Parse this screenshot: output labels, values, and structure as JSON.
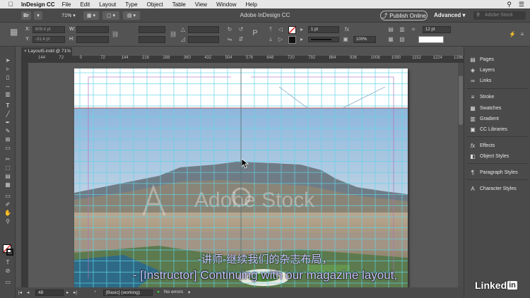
{
  "menubar": {
    "app": "InDesign CC",
    "items": [
      "File",
      "Edit",
      "Layout",
      "Type",
      "Object",
      "Table",
      "View",
      "Window",
      "Help"
    ]
  },
  "appbar": {
    "zoom": "71%",
    "title": "Adobe InDesign CC",
    "publish_label": "Publish Online",
    "workspace": "Advanced",
    "search_placeholder": "Adobe Stock"
  },
  "control": {
    "x_label": "X:",
    "x_value": "609.4 pt",
    "y_label": "Y:",
    "y_value": "-31.4 pt",
    "w_label": "W:",
    "h_label": "H:",
    "stroke_weight": "1 pt",
    "opacity": "100%",
    "gutter": "12 pt"
  },
  "document": {
    "tab_label": "Layout5.indd @ 71%",
    "ruler_ticks": [
      "144",
      "72",
      "0",
      "72",
      "144",
      "216",
      "288",
      "360",
      "432",
      "504",
      "576",
      "648",
      "720",
      "792",
      "864",
      "936",
      "1008",
      "1080",
      "1152",
      "1224",
      "1296"
    ],
    "watermark": "Adobe Stock"
  },
  "status": {
    "page": "48",
    "style": "[Basic] (working)",
    "errors": "No errors"
  },
  "panels": {
    "items": [
      {
        "icon": "pages-icon",
        "label": "Pages"
      },
      {
        "icon": "layers-icon",
        "label": "Layers"
      },
      {
        "icon": "links-icon",
        "label": "Links"
      },
      {
        "icon": "stroke-icon",
        "label": "Stroke"
      },
      {
        "icon": "swatches-icon",
        "label": "Swatches"
      },
      {
        "icon": "gradient-icon",
        "label": "Gradient"
      },
      {
        "icon": "cc-libraries-icon",
        "label": "CC Libraries"
      },
      {
        "icon": "effects-icon",
        "label": "Effects"
      },
      {
        "icon": "object-styles-icon",
        "label": "Object Styles"
      },
      {
        "icon": "paragraph-styles-icon",
        "label": "Paragraph Styles"
      },
      {
        "icon": "character-styles-icon",
        "label": "Character Styles"
      }
    ]
  },
  "subtitles": {
    "chinese": "-讲师-继续我们的杂志布局，",
    "english": "- [Instructor] Continuing with our magazine layout,"
  },
  "brand": {
    "logo_text": "Linked",
    "logo_in": "in"
  },
  "colors": {
    "guide": "#5fd5e8",
    "margin_guide": "#b070c0",
    "publish_border": "#bbbbbb",
    "subtitle": "#c8c4ff"
  }
}
